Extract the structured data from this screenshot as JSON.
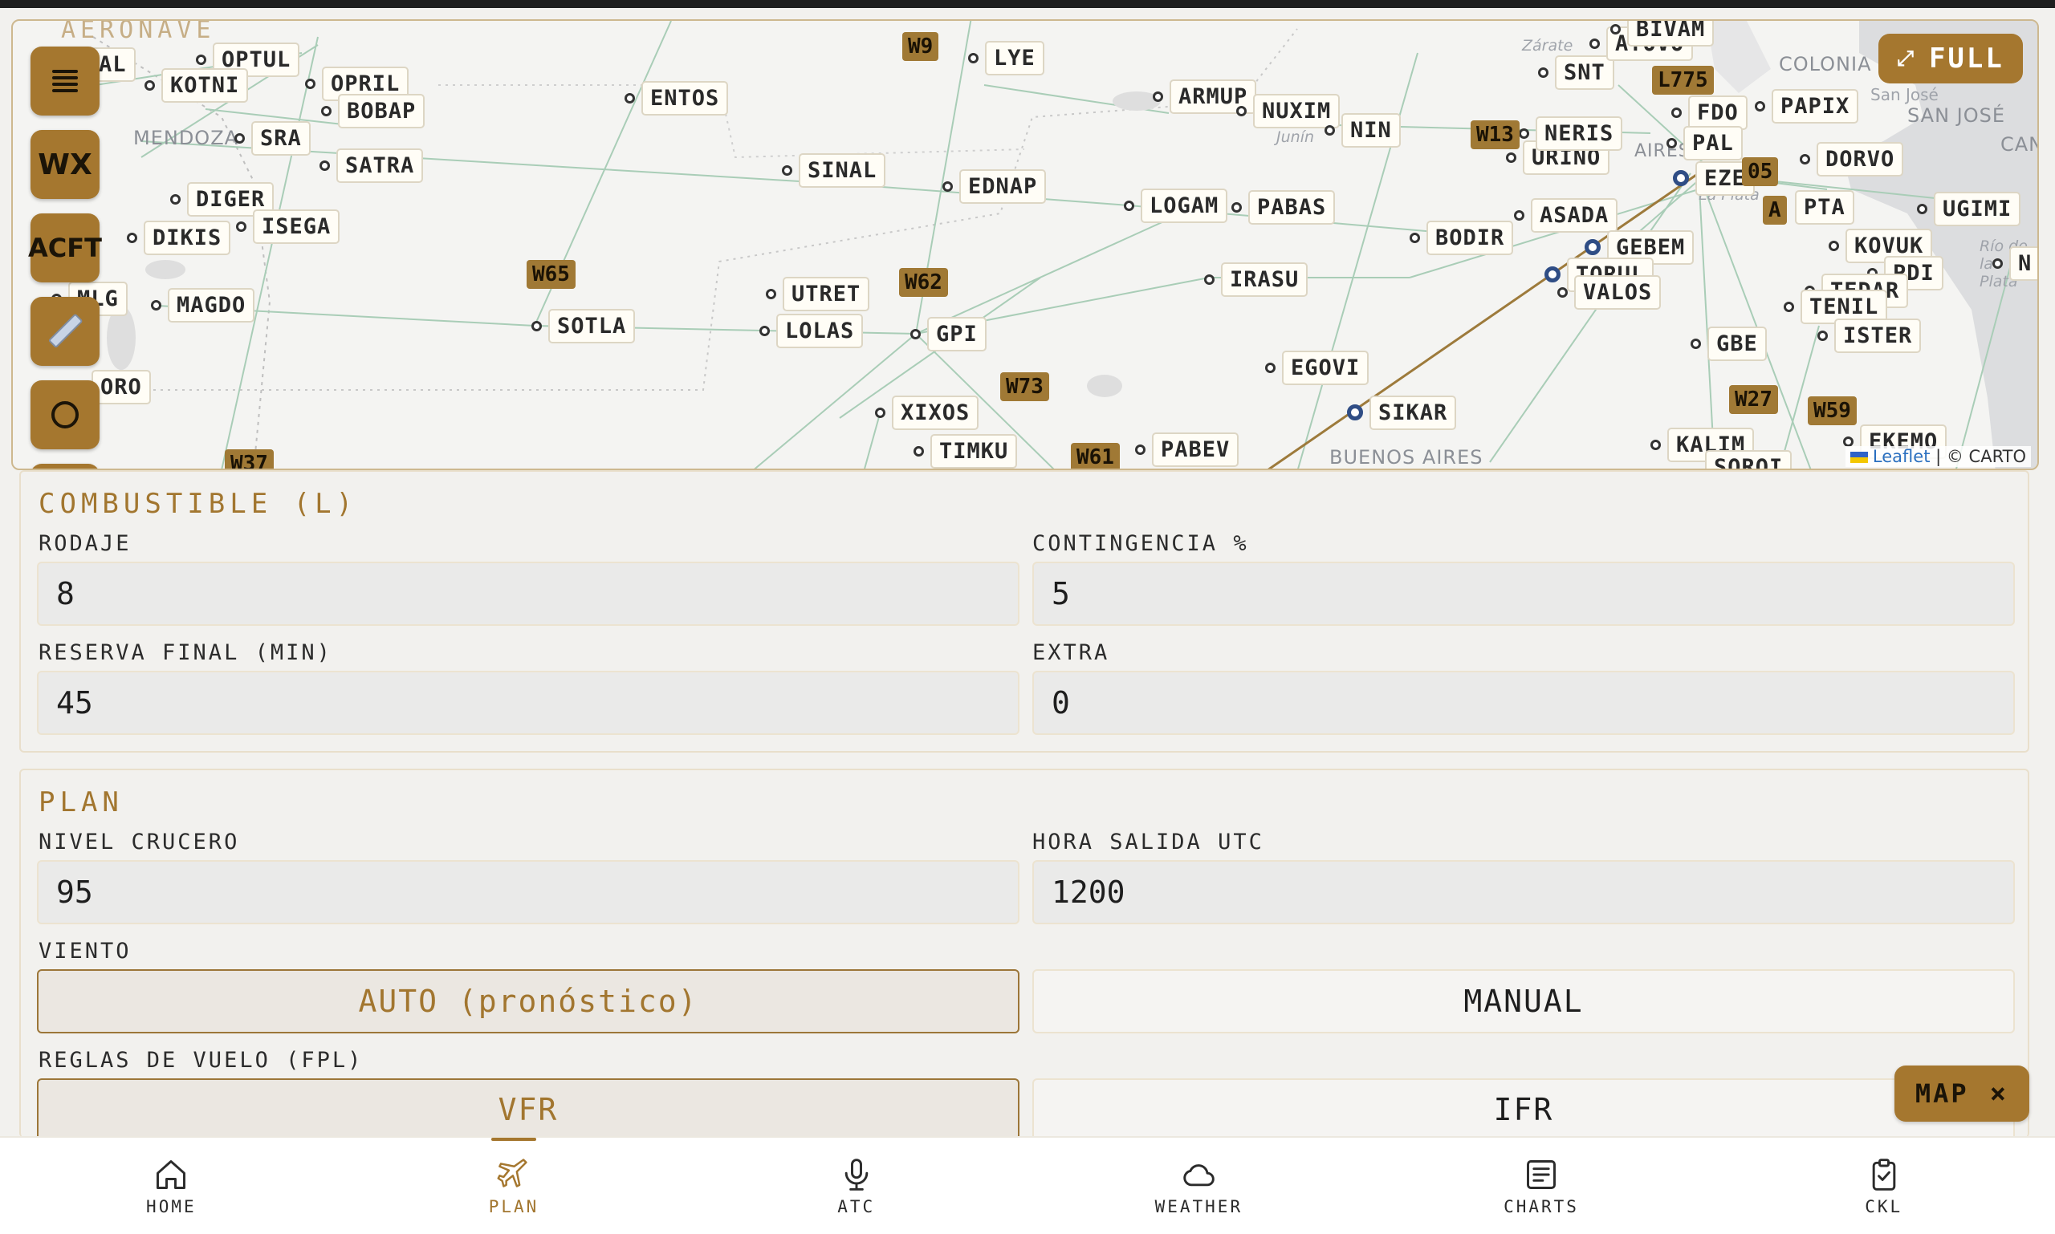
{
  "map": {
    "section_peek": "AERONAVE",
    "full_button": "FULL",
    "attribution_leaflet": "Leaflet",
    "attribution_rest": "| © CARTO",
    "tools": [
      {
        "name": "layers",
        "label": ""
      },
      {
        "name": "wx",
        "label": "WX"
      },
      {
        "name": "acft",
        "label": "ACFT"
      },
      {
        "name": "ruler",
        "label": ""
      },
      {
        "name": "circle",
        "label": ""
      }
    ],
    "fixes": [
      "OPTUL",
      "KOTNI",
      "OPRIL",
      "BOBAP",
      "SRA",
      "SATRA",
      "DIGER",
      "DIKIS",
      "ISEGA",
      "MLG",
      "MAGDO",
      "ORO",
      "ENTOS",
      "SINAL",
      "EDNAP",
      "LYE",
      "ARMUP",
      "NUXIM",
      "NIN",
      "LOGAM",
      "PABAS",
      "UTRET",
      "LOLAS",
      "GPI",
      "SOTLA",
      "IRASU",
      "EGOVI",
      "XIXOS",
      "TIMKU",
      "PABEV",
      "SIKAR",
      "BODIR",
      "ASADA",
      "GEBEM",
      "TORUL",
      "VALOS",
      "URINO",
      "NERIS",
      "SNT",
      "ATOVO",
      "BIVAM",
      "FDO",
      "PAL",
      "EZE",
      "PAPIX",
      "DORVO",
      "PTA",
      "UGIMI",
      "KOVUK",
      "PDI",
      "TEDAR",
      "TENIL",
      "ISTER",
      "GBE",
      "KALIM",
      "EKEMO",
      "AL",
      "N",
      "SOROI"
    ],
    "airways": [
      "W9",
      "W65",
      "W62",
      "W73",
      "W61",
      "W13",
      "L775",
      "W27",
      "W59",
      "W37",
      "05",
      "A"
    ],
    "places": [
      "MENDOZA",
      "COLONIA",
      "San José",
      "SAN JOSÉ",
      "CANE",
      "Zárate",
      "Junín",
      "La Plata",
      "BUENOS AIRES",
      "Río de la Plata",
      "AIRES"
    ]
  },
  "combustible": {
    "title": "COMBUSTIBLE (L)",
    "rodaje_label": "RODAJE",
    "rodaje_value": "8",
    "contingencia_label": "CONTINGENCIA %",
    "contingencia_value": "5",
    "reserva_label": "RESERVA FINAL (MIN)",
    "reserva_value": "45",
    "extra_label": "EXTRA",
    "extra_value": "0"
  },
  "plan": {
    "title": "PLAN",
    "nivel_label": "NIVEL CRUCERO",
    "nivel_value": "95",
    "hora_label": "HORA SALIDA UTC",
    "hora_value": "1200",
    "viento_label": "VIENTO",
    "viento_auto": "AUTO (pronóstico)",
    "viento_manual": "MANUAL",
    "reglas_label": "REGLAS DE VUELO (FPL)",
    "reglas_vfr": "VFR",
    "reglas_ifr": "IFR"
  },
  "map_toggle": {
    "label": "MAP",
    "close": "×"
  },
  "nav": {
    "home": "HOME",
    "plan": "PLAN",
    "atc": "ATC",
    "weather": "WEATHER",
    "charts": "CHARTS",
    "ckl": "CKL",
    "active": "plan"
  },
  "colors": {
    "accent": "#a5772f",
    "accent_text": "#a2762f",
    "vor": "#2f4d85"
  }
}
